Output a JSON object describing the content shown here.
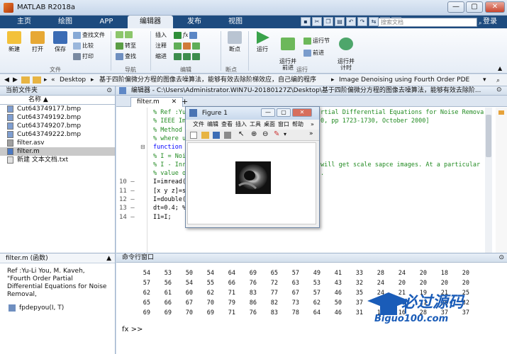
{
  "window": {
    "title": "MATLAB R2018a",
    "min": "—",
    "max": "▢",
    "close": "✕"
  },
  "tabs": [
    {
      "label": "主页"
    },
    {
      "label": "绘图"
    },
    {
      "label": "APP"
    },
    {
      "label": "编辑器"
    },
    {
      "label": "发布"
    },
    {
      "label": "视图"
    }
  ],
  "search": {
    "placeholder": "搜索文档"
  },
  "login": "登录",
  "ribbon": {
    "new": "新建",
    "open": "打开",
    "save": "保存",
    "find_files": "查找文件",
    "compare": "比较",
    "print": "打印",
    "goto": "转至",
    "find": "查找",
    "insert": "插入",
    "comment": "注释",
    "indent": "缩进",
    "fx": "fx",
    "breakpoints": "断点",
    "run": "运行",
    "run_advance": "运行并\n前进",
    "run_section": "运行节",
    "advance": "前进",
    "run_time": "运行并\n计时",
    "groups": {
      "file": "文件",
      "navigate": "导航",
      "edit": "编辑",
      "breakpoints": "断点",
      "run": "运行"
    }
  },
  "path": {
    "segments": [
      "«",
      "Desktop",
      "基于四阶偏微分方程的图像去噪算法，能够有效去除阶梯效应，自己编的程序",
      "Image Denoising using Fourth Order PDE"
    ]
  },
  "current_folder": {
    "title": "当前文件夹",
    "column": "名称 ▲",
    "files": [
      {
        "name": "Cut643749177.bmp",
        "type": "bmp"
      },
      {
        "name": "Cut643749192.bmp",
        "type": "bmp"
      },
      {
        "name": "Cut643749207.bmp",
        "type": "bmp"
      },
      {
        "name": "Cut643749222.bmp",
        "type": "bmp"
      },
      {
        "name": "filter.asv",
        "type": "asv"
      },
      {
        "name": "filter.m",
        "type": "m",
        "selected": true
      },
      {
        "name": "新建 文本文档.txt",
        "type": "txt"
      }
    ]
  },
  "details": {
    "header": "filter.m  (函数)",
    "text": "Ref :Yu-Li You, M. Kaveh, \"Fourth Order Partial Differential Equations for Noise Removal,",
    "func": "fpdepyou(I, T)"
  },
  "editor": {
    "header": "编辑器 - C:\\Users\\Administrator.WIN7U-20180127Z\\Desktop\\基于四阶偏微分方程的图像去噪算法，能够有效去除阶...",
    "tab": "filter.m",
    "add_tab": "+",
    "lines": [
      {
        "n": "",
        "t": "% Ref :Yu",
        "cls": "cm",
        "tail": "rtial Differential Equations for Noise Remova"
      },
      {
        "n": "",
        "t": "% IEEE Im",
        "cls": "cm",
        "tail": "0, pp 1723-1730, October 2000]"
      },
      {
        "n": "",
        "t": "% Method",
        "cls": "cm",
        "tail": ""
      },
      {
        "n": "",
        "t": "% where u",
        "cls": "cm",
        "tail": ""
      },
      {
        "n": "",
        "t": "function",
        "cls": "kw",
        "tail": ""
      },
      {
        "n": "",
        "t": "% I = Noi",
        "cls": "cm",
        "tail": ""
      },
      {
        "n": "",
        "t": "% I - Inr",
        "cls": "cm",
        "tail": "will get scale sapce images. At a particular"
      },
      {
        "n": "",
        "t": "% value o",
        "cls": "cm",
        "tail": "."
      },
      {
        "n": "10",
        "t": "I=imread(",
        "cls": "",
        "tail": ""
      },
      {
        "n": "11",
        "t": "[x y z]=s",
        "cls": "",
        "tail": ""
      },
      {
        "n": "12",
        "t": "I=double(",
        "cls": "",
        "tail": ""
      },
      {
        "n": "13",
        "t": "dt=0.4; % Time step",
        "cls": "",
        "tail": ""
      },
      {
        "n": "14",
        "t": "I1=I;",
        "cls": "",
        "tail": ""
      }
    ]
  },
  "figure": {
    "title": "Figure 1",
    "menu": [
      "文件",
      "编辑",
      "查看",
      "插入",
      "工具",
      "桌面",
      "窗口",
      "帮助"
    ]
  },
  "command": {
    "title": "命令行窗口",
    "prompt": "fx >>",
    "rows": [
      [
        "54",
        "53",
        "50",
        "54",
        "64",
        "69",
        "65",
        "57",
        "49",
        "41",
        "33",
        "28",
        "24",
        "20",
        "18",
        "20"
      ],
      [
        "57",
        "56",
        "54",
        "55",
        "66",
        "76",
        "72",
        "63",
        "53",
        "43",
        "32",
        "24",
        "20",
        "20",
        "20",
        "20"
      ],
      [
        "62",
        "61",
        "60",
        "62",
        "71",
        "83",
        "77",
        "67",
        "57",
        "46",
        "35",
        "24",
        "21",
        "19",
        "21",
        "25"
      ],
      [
        "65",
        "66",
        "67",
        "70",
        "79",
        "86",
        "82",
        "73",
        "62",
        "50",
        "37",
        "24",
        "21",
        "21",
        "28",
        "32"
      ],
      [
        "69",
        "69",
        "70",
        "69",
        "71",
        "76",
        "83",
        "78",
        "64",
        "46",
        "31",
        "18",
        "16",
        "28",
        "37",
        "37"
      ]
    ]
  },
  "watermark": {
    "brand": "必过源码",
    "url": "Biguo100.com"
  }
}
